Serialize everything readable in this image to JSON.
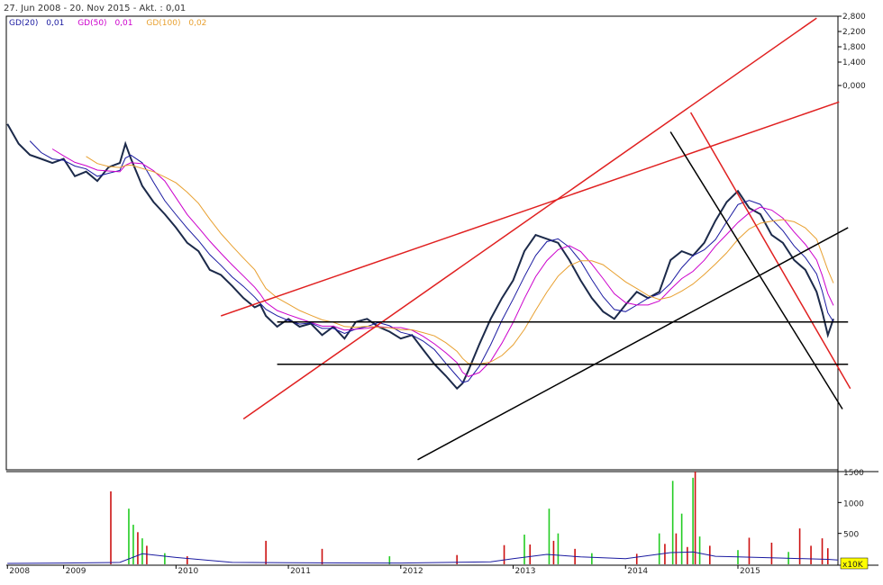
{
  "header": {
    "title": "27. Jun 2008 - 20. Nov 2015 - Akt. : 0,01"
  },
  "legend": {
    "items": [
      {
        "label": "GD(20)",
        "value": "0,01",
        "color": "#1a1aa0"
      },
      {
        "label": "GD(50)",
        "value": "0,01",
        "color": "#cc00cc"
      },
      {
        "label": "GD(100)",
        "value": "0,02",
        "color": "#e8a030"
      }
    ]
  },
  "colors": {
    "price": "#1c2a4a",
    "trend_red": "#e02020",
    "trend_black": "#000000",
    "vol_green": "#22cc22",
    "vol_red": "#cc1111",
    "vol_avg": "#1a1aa0",
    "frame": "#000000"
  },
  "chart_data": [
    {
      "type": "line",
      "panel": "price",
      "y_scale": "log",
      "ytick_labels": [
        "2,800",
        "2,200",
        "1,800",
        "1,400",
        "0,000"
      ],
      "x_tick_labels": [
        "2008",
        "2009",
        "2010",
        "2011",
        "2012",
        "2013",
        "2014",
        "2015"
      ],
      "x_ticks_years": [
        2008.5,
        2009.0,
        2010.0,
        2011.0,
        2012.0,
        2013.0,
        2014.0,
        2015.0
      ],
      "xlim": [
        2008.49,
        2015.89
      ],
      "price_series": {
        "x": [
          2008.5,
          2008.6,
          2008.7,
          2008.8,
          2008.9,
          2009.0,
          2009.1,
          2009.2,
          2009.3,
          2009.4,
          2009.5,
          2009.55,
          2009.6,
          2009.7,
          2009.8,
          2009.9,
          2010.0,
          2010.1,
          2010.2,
          2010.3,
          2010.4,
          2010.5,
          2010.6,
          2010.7,
          2010.75,
          2010.8,
          2010.9,
          2011.0,
          2011.1,
          2011.2,
          2011.3,
          2011.4,
          2011.5,
          2011.6,
          2011.7,
          2011.8,
          2011.9,
          2012.0,
          2012.1,
          2012.2,
          2012.3,
          2012.4,
          2012.5,
          2012.55,
          2012.6,
          2012.7,
          2012.8,
          2012.9,
          2013.0,
          2013.1,
          2013.2,
          2013.3,
          2013.4,
          2013.5,
          2013.6,
          2013.7,
          2013.8,
          2013.9,
          2014.0,
          2014.1,
          2014.2,
          2014.3,
          2014.4,
          2014.5,
          2014.6,
          2014.7,
          2014.8,
          2014.9,
          2015.0,
          2015.1,
          2015.2,
          2015.3,
          2015.4,
          2015.5,
          2015.6,
          2015.7,
          2015.75,
          2015.8,
          2015.85
        ],
        "y": [
          0.04,
          0.034,
          0.031,
          0.03,
          0.029,
          0.03,
          0.026,
          0.027,
          0.025,
          0.028,
          0.029,
          0.034,
          0.03,
          0.024,
          0.021,
          0.019,
          0.017,
          0.015,
          0.014,
          0.012,
          0.0115,
          0.0105,
          0.0095,
          0.0088,
          0.009,
          0.0082,
          0.0075,
          0.008,
          0.0075,
          0.0077,
          0.007,
          0.0075,
          0.0068,
          0.0078,
          0.008,
          0.0075,
          0.0072,
          0.0068,
          0.007,
          0.0062,
          0.0055,
          0.005,
          0.0045,
          0.0047,
          0.0052,
          0.0065,
          0.008,
          0.0095,
          0.011,
          0.014,
          0.016,
          0.0155,
          0.015,
          0.013,
          0.011,
          0.0095,
          0.0085,
          0.008,
          0.009,
          0.01,
          0.0095,
          0.01,
          0.013,
          0.014,
          0.0135,
          0.015,
          0.018,
          0.021,
          0.023,
          0.02,
          0.019,
          0.016,
          0.015,
          0.013,
          0.012,
          0.01,
          0.0085,
          0.007,
          0.008
        ]
      },
      "moving_averages": [
        {
          "name": "GD(20)",
          "window": 2
        },
        {
          "name": "GD(50)",
          "window": 4
        },
        {
          "name": "GD(100)",
          "window": 7
        }
      ],
      "trendlines": [
        {
          "color": "red",
          "x": [
            2010.4,
            2015.9
          ],
          "y": [
            0.0082,
            0.048
          ]
        },
        {
          "color": "red",
          "x": [
            2010.6,
            2015.7
          ],
          "y": [
            0.0035,
            0.096
          ]
        },
        {
          "color": "red",
          "x": [
            2014.58,
            2016.0
          ],
          "y": [
            0.044,
            0.0045
          ]
        },
        {
          "color": "black",
          "x": [
            2012.15,
            2015.98
          ],
          "y": [
            0.0025,
            0.017
          ]
        },
        {
          "color": "black",
          "x": [
            2014.4,
            2015.93
          ],
          "y": [
            0.0375,
            0.0038
          ]
        },
        {
          "color": "black",
          "x": [
            2010.9,
            2015.98
          ],
          "y": [
            0.0078,
            0.0078
          ]
        },
        {
          "color": "black",
          "x": [
            2010.9,
            2015.98
          ],
          "y": [
            0.0055,
            0.0055
          ]
        }
      ]
    },
    {
      "type": "bar",
      "panel": "volume",
      "ytick_labels": [
        "1500",
        "1000",
        "500"
      ],
      "ytick_values": [
        1500,
        1000,
        500
      ],
      "ylim": [
        0,
        1500
      ],
      "unit_label": "x10K",
      "bars": [
        {
          "x": 2009.42,
          "value": 1180,
          "color": "red"
        },
        {
          "x": 2009.58,
          "value": 900,
          "color": "green"
        },
        {
          "x": 2009.62,
          "value": 640,
          "color": "green"
        },
        {
          "x": 2009.66,
          "value": 520,
          "color": "red"
        },
        {
          "x": 2009.7,
          "value": 420,
          "color": "green"
        },
        {
          "x": 2009.74,
          "value": 300,
          "color": "red"
        },
        {
          "x": 2009.9,
          "value": 180,
          "color": "green"
        },
        {
          "x": 2010.1,
          "value": 130,
          "color": "red"
        },
        {
          "x": 2010.8,
          "value": 380,
          "color": "red"
        },
        {
          "x": 2011.3,
          "value": 250,
          "color": "red"
        },
        {
          "x": 2011.9,
          "value": 130,
          "color": "green"
        },
        {
          "x": 2012.5,
          "value": 150,
          "color": "red"
        },
        {
          "x": 2012.92,
          "value": 310,
          "color": "red"
        },
        {
          "x": 2013.1,
          "value": 480,
          "color": "green"
        },
        {
          "x": 2013.15,
          "value": 320,
          "color": "red"
        },
        {
          "x": 2013.32,
          "value": 900,
          "color": "green"
        },
        {
          "x": 2013.36,
          "value": 380,
          "color": "red"
        },
        {
          "x": 2013.4,
          "value": 500,
          "color": "green"
        },
        {
          "x": 2013.55,
          "value": 250,
          "color": "red"
        },
        {
          "x": 2013.7,
          "value": 180,
          "color": "green"
        },
        {
          "x": 2014.1,
          "value": 170,
          "color": "red"
        },
        {
          "x": 2014.3,
          "value": 500,
          "color": "green"
        },
        {
          "x": 2014.35,
          "value": 330,
          "color": "red"
        },
        {
          "x": 2014.42,
          "value": 1350,
          "color": "green"
        },
        {
          "x": 2014.45,
          "value": 500,
          "color": "red"
        },
        {
          "x": 2014.5,
          "value": 820,
          "color": "green"
        },
        {
          "x": 2014.55,
          "value": 280,
          "color": "red"
        },
        {
          "x": 2014.6,
          "value": 1400,
          "color": "green"
        },
        {
          "x": 2014.62,
          "value": 1500,
          "color": "red"
        },
        {
          "x": 2014.66,
          "value": 450,
          "color": "green"
        },
        {
          "x": 2014.75,
          "value": 300,
          "color": "red"
        },
        {
          "x": 2015.0,
          "value": 230,
          "color": "green"
        },
        {
          "x": 2015.1,
          "value": 430,
          "color": "red"
        },
        {
          "x": 2015.3,
          "value": 350,
          "color": "red"
        },
        {
          "x": 2015.45,
          "value": 200,
          "color": "green"
        },
        {
          "x": 2015.55,
          "value": 580,
          "color": "red"
        },
        {
          "x": 2015.65,
          "value": 300,
          "color": "red"
        },
        {
          "x": 2015.75,
          "value": 420,
          "color": "red"
        },
        {
          "x": 2015.8,
          "value": 260,
          "color": "red"
        }
      ],
      "avg_line": {
        "x": [
          2008.5,
          2009.0,
          2009.5,
          2009.7,
          2010.0,
          2010.5,
          2011.0,
          2012.0,
          2012.8,
          2013.0,
          2013.3,
          2013.6,
          2014.0,
          2014.4,
          2014.6,
          2014.8,
          2015.0,
          2015.4,
          2015.8,
          2015.89
        ],
        "y": [
          15,
          20,
          30,
          170,
          110,
          30,
          25,
          20,
          40,
          90,
          160,
          120,
          90,
          190,
          200,
          130,
          120,
          100,
          80,
          70
        ]
      }
    }
  ]
}
